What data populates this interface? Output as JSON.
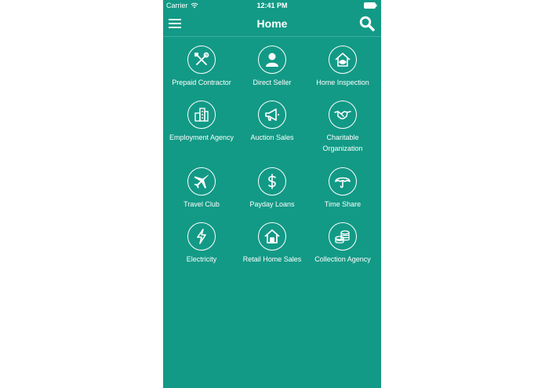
{
  "status_bar": {
    "carrier": "Carrier",
    "time": "12:41 PM"
  },
  "nav": {
    "title": "Home",
    "menu_icon": "hamburger-menu-icon",
    "search_icon": "search-icon"
  },
  "colors": {
    "background": "#129a86",
    "foreground": "#ffffff"
  },
  "tiles": [
    {
      "label": "Prepaid Contractor",
      "icon": "tools-icon"
    },
    {
      "label": "Direct Seller",
      "icon": "person-icon"
    },
    {
      "label": "Home Inspection",
      "icon": "home-eye-icon"
    },
    {
      "label": "Employment Agency",
      "icon": "buildings-icon"
    },
    {
      "label": "Auction Sales",
      "icon": "megaphone-icon"
    },
    {
      "label": "Charitable Organization",
      "icon": "handshake-icon"
    },
    {
      "label": "Travel Club",
      "icon": "airplane-icon"
    },
    {
      "label": "Payday Loans",
      "icon": "dollar-icon"
    },
    {
      "label": "Time Share",
      "icon": "umbrella-icon"
    },
    {
      "label": "Electricity",
      "icon": "lightning-icon"
    },
    {
      "label": "Retail Home Sales",
      "icon": "house-icon"
    },
    {
      "label": "Collection Agency",
      "icon": "coins-icon"
    }
  ]
}
